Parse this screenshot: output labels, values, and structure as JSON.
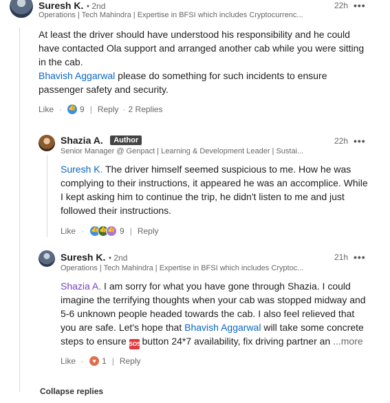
{
  "comment1": {
    "author": "Suresh K.",
    "degree": "• 2nd",
    "headline": "Operations | Tech Mahindra | Expertise in BFSI which includes Cryptocurrenc...",
    "time": "22h",
    "menu": "•••",
    "text_line1": "At least the driver should have understood his responsibility and he could",
    "text_line2": "have contacted Ola support and arranged another cab while you were sitting",
    "text_line3": "in the cab.",
    "mention": "Bhavish Aggarwal",
    "text_after_mention": " please do something for such incidents to ensure",
    "text_line5": "passenger safety and security.",
    "like_label": "Like",
    "reaction_count": "9",
    "reply_label": "Reply",
    "replies_label": "2 Replies"
  },
  "reply1": {
    "author": "Shazia A.",
    "badge": "Author",
    "headline": "Senior Manager @ Genpact | Learning & Development Leader | Sustai...",
    "time": "22h",
    "menu": "•••",
    "mention": "Suresh K.",
    "text_after_mention": " The driver himself seemed suspicious to me. How he was",
    "text_line2": "complying to their instructions, it appeared he was an accomplice. While",
    "text_line3": "I kept asking him to continue the trip, he didn't listen to me and just",
    "text_line4": "followed their instructions.",
    "like_label": "Like",
    "reaction_count": "9",
    "reply_label": "Reply"
  },
  "reply2": {
    "author": "Suresh K.",
    "degree": "• 2nd",
    "headline": "Operations | Tech Mahindra | Expertise in BFSI which includes Cryptoc...",
    "time": "21h",
    "menu": "•••",
    "mention": "Shazia A.",
    "text_after_mention": " I am sorry for what you have gone through Shazia. I could",
    "text_line2": "imagine the terrifying thoughts when your cab was stopped midway and",
    "text_line3": "5-6 unknown people headed towards the cab. I also feel relieved that",
    "text_line4_a": "you are safe. Let's hope that ",
    "mention2": "Bhavish Aggarwal",
    "text_line4_b": " will take some concrete",
    "text_line5_a": "steps to ensure ",
    "sos_label": "SOS",
    "text_line5_b": " button 24*7 availability, fix driving partner an",
    "more_label": "...more",
    "like_label": "Like",
    "reaction_count": "1",
    "reply_label": "Reply"
  },
  "collapse_label": "Collapse replies"
}
